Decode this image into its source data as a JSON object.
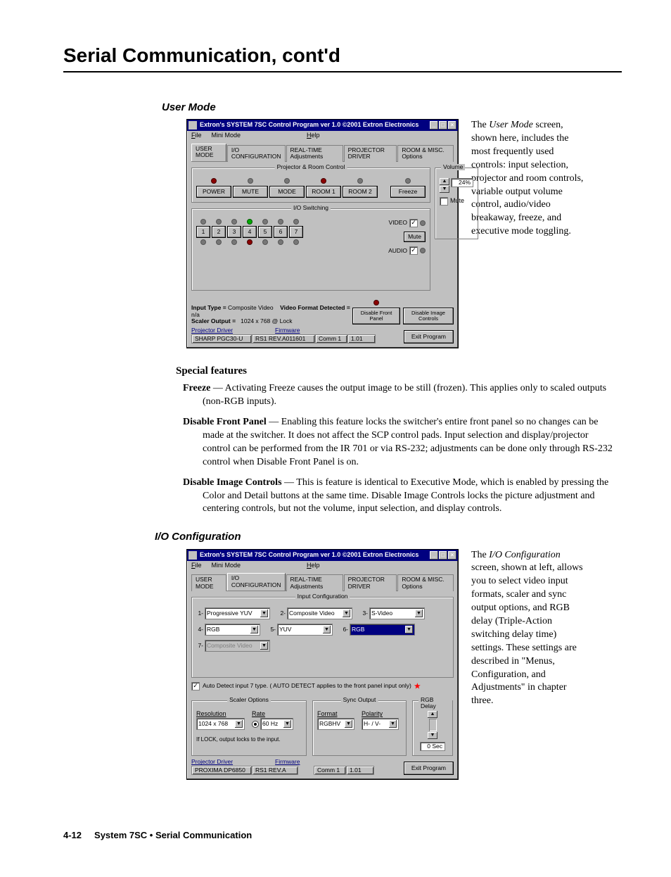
{
  "page_title": "Serial Communication, cont'd",
  "user_mode": {
    "heading": "User Mode",
    "window": {
      "title": "Extron's SYSTEM 7SC Control Program    ver 1.0    ©2001 Extron Electronics",
      "menu_file": "File",
      "menu_mini": "Mini Mode",
      "menu_help": "Help",
      "tabs": [
        "USER MODE",
        "I/O CONFIGURATION",
        "REAL-TIME Adjustments",
        "PROJECTOR DRIVER",
        "ROOM & MISC. Options"
      ],
      "prc_legend": "Projector & Room Control",
      "prc_btns": [
        "POWER",
        "MUTE",
        "MODE",
        "ROOM 1",
        "ROOM 2"
      ],
      "freeze": "Freeze",
      "vol_legend": "Volume",
      "vol_value": "24%",
      "vol_mute": "Mute",
      "io_legend": "I/O Switching",
      "io_video": "VIDEO",
      "io_mute": "Mute",
      "io_audio": "AUDIO",
      "input_type_label": "Input Type =",
      "input_type_val": "Composite Video",
      "vfd_label": "Video Format Detected =",
      "vfd_val": "n/a",
      "scaler_out_label": "Scaler Output =",
      "scaler_out_val": "1024 x 768 @ Lock",
      "btn_dfp": "Disable Front Panel",
      "btn_dic": "Disable Image Controls",
      "link_pd": "Projector Driver",
      "link_fw": "Firmware",
      "ft_driver": "SHARP PGC30-U",
      "ft_rev": "RS1 REV.A011601",
      "ft_comm": "Comm 1",
      "ft_ver": "1.01",
      "exit": "Exit Program"
    },
    "caption": {
      "p1a": "The ",
      "p1i": "User Mode",
      "p1b": " screen, shown here, includes the most frequently used controls: input selection, projector and room controls, variable output volume control, audio/video breakaway, freeze, and executive mode toggling."
    }
  },
  "special_features": {
    "heading": "Special features",
    "freeze_b": "Freeze",
    "freeze_t": " — Activating Freeze causes the output image to be still (frozen).  This applies only to scaled outputs (non-RGB inputs).",
    "dfp_b": "Disable Front Panel",
    "dfp_t": " — Enabling this feature locks the switcher's entire front panel so no changes can be made at the switcher.  It does not affect the SCP control pads.  Input selection and display/projector control can be performed from the IR 701 or via RS-232; adjustments can be done only through RS-232 control when Disable Front Panel is on.",
    "dic_b": "Disable Image Controls",
    "dic_t": " — This is feature is identical to Executive Mode, which is enabled by pressing the Color and Detail buttons at the same time.  Disable Image Controls locks the picture adjustment and centering controls, but not the volume, input selection, and display controls."
  },
  "io_config": {
    "heading": "I/O Configuration",
    "window": {
      "title": "Extron's SYSTEM 7SC Control Program    ver 1.0    ©2001 Extron Electronics",
      "menu_file": "File",
      "menu_mini": "Mini Mode",
      "menu_help": "Help",
      "tabs": [
        "USER MODE",
        "I/O CONFIGURATION",
        "REAL-TIME Adjustments",
        "PROJECTOR DRIVER",
        "ROOM & MISC. Options"
      ],
      "ic_legend": "Input Configuration",
      "inputs": [
        {
          "n": "1-",
          "v": "Progressive YUV"
        },
        {
          "n": "2-",
          "v": "Composite Video"
        },
        {
          "n": "3-",
          "v": "S-Video"
        },
        {
          "n": "4-",
          "v": "RGB"
        },
        {
          "n": "5-",
          "v": "YUV"
        },
        {
          "n": "6-",
          "v": "RGB"
        },
        {
          "n": "7-",
          "v": "Composite Video"
        }
      ],
      "auto_detect": "Auto Detect input 7 type. ( AUTO DETECT applies to the front panel  input only)",
      "scaler_legend": "Scaler Options",
      "resolution_l": "Resolution",
      "resolution_v": "1024 x 768",
      "rate_l": "Rate",
      "rate_v": "60 Hz",
      "lock_note": "If LOCK, output locks to the input.",
      "sync_legend": "Sync Output",
      "format_l": "Format",
      "format_v": "RGBHV",
      "polarity_l": "Polarity",
      "polarity_v": "H- / V-",
      "rgb_legend": "RGB Delay",
      "rgb_val": "0 Sec",
      "link_pd": "Projector Driver",
      "link_fw": "Firmware",
      "ft_driver": "PROXIMA DP6850",
      "ft_rev": "RS1 REV.A",
      "ft_comm": "Comm 1",
      "ft_ver": "1.01",
      "exit": "Exit Program"
    },
    "caption": {
      "p1a": "The ",
      "p1i": "I/O Configuration",
      "p1b": " screen, shown at left, allows you to select video input formats, scaler and sync output options, and RGB delay (Triple-Action switching delay time) settings.  These settings are described in \"Menus, Configuration, and Adjustments\" in chapter three."
    }
  },
  "footer": {
    "num": "4-12",
    "text": "System 7SC • Serial Communication"
  }
}
